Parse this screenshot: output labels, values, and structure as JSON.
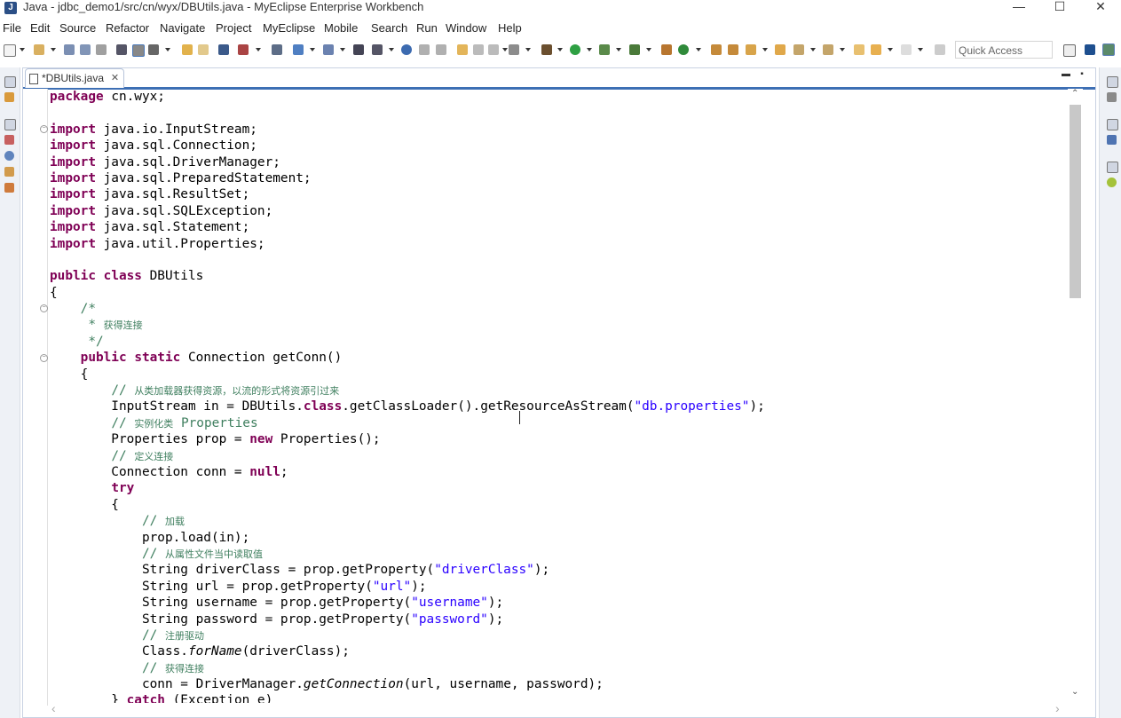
{
  "window": {
    "title": "Java - jdbc_demo1/src/cn/wyx/DBUtils.java - MyEclipse Enterprise Workbench",
    "minimize": "—",
    "maximize": "☐",
    "close": "✕"
  },
  "menu": [
    "File",
    "Edit",
    "Source",
    "Refactor",
    "Navigate",
    "Project",
    "MyEclipse",
    "Mobile",
    "Search",
    "Run",
    "Window",
    "Help"
  ],
  "toolbar": {
    "quick_access": "Quick Access"
  },
  "editor": {
    "tab_label": "*DBUtils.java",
    "tab_close": "✕",
    "minimize": "▬",
    "maximize": "▪"
  },
  "code_lines": [
    "package cn.wyx;",
    "",
    "import java.io.InputStream;",
    "import java.sql.Connection;",
    "import java.sql.DriverManager;",
    "import java.sql.PreparedStatement;",
    "import java.sql.ResultSet;",
    "import java.sql.SQLException;",
    "import java.sql.Statement;",
    "import java.util.Properties;",
    "",
    "public class DBUtils",
    "{",
    "    /*",
    "     * 获得连接",
    "     */",
    "    public static Connection getConn()",
    "    {",
    "        // 从类加载器获得资源，以流的形式将资源引过来",
    "        InputStream in = DBUtils.class.getClassLoader().getResourceAsStream(\"db.properties\");",
    "        // 实例化类 Properties",
    "        Properties prop = new Properties();",
    "        // 定义连接",
    "        Connection conn = null;",
    "        try",
    "        {",
    "            // 加载",
    "            prop.load(in);",
    "            // 从属性文件当中读取值",
    "            String driverClass = prop.getProperty(\"driverClass\");",
    "            String url = prop.getProperty(\"url\");",
    "            String username = prop.getProperty(\"username\");",
    "            String password = prop.getProperty(\"password\");",
    "            // 注册驱动",
    "            Class.forName(driverClass);",
    "            // 获得连接",
    "            conn = DriverManager.getConnection(url, username, password);",
    "        } catch (Exception e)"
  ],
  "scroll": {
    "up": "⌃",
    "down": "⌄",
    "left": "‹",
    "right": "›"
  }
}
